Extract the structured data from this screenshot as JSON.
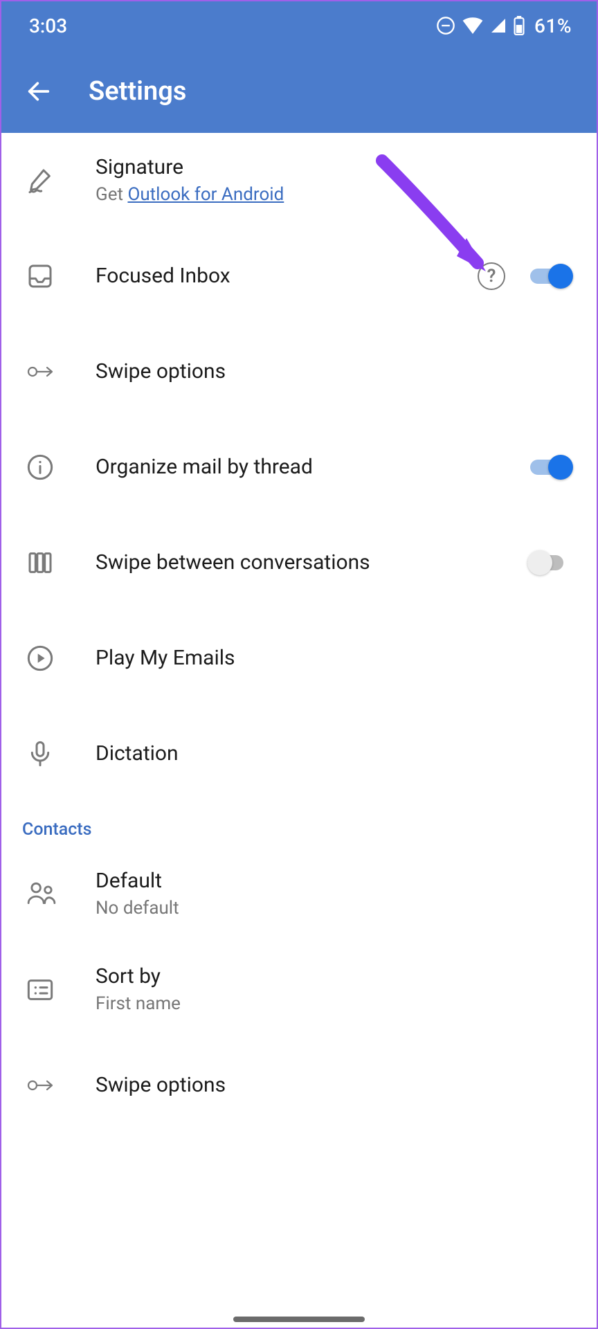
{
  "status": {
    "time": "3:03",
    "battery_pct": "61%"
  },
  "header": {
    "title": "Settings"
  },
  "rows": {
    "signature": {
      "title": "Signature",
      "subtitle_prefix": "Get ",
      "subtitle_link": "Outlook for Android"
    },
    "focused": {
      "title": "Focused Inbox"
    },
    "swipe": {
      "title": "Swipe options"
    },
    "thread": {
      "title": "Organize mail by thread"
    },
    "swipeconv": {
      "title": "Swipe between conversations"
    },
    "play": {
      "title": "Play My Emails"
    },
    "dictation": {
      "title": "Dictation"
    },
    "default": {
      "title": "Default",
      "subtitle": "No default"
    },
    "sortby": {
      "title": "Sort by",
      "subtitle": "First name"
    },
    "swipe2": {
      "title": "Swipe options"
    }
  },
  "sections": {
    "contacts": "Contacts"
  },
  "help_label": "?"
}
